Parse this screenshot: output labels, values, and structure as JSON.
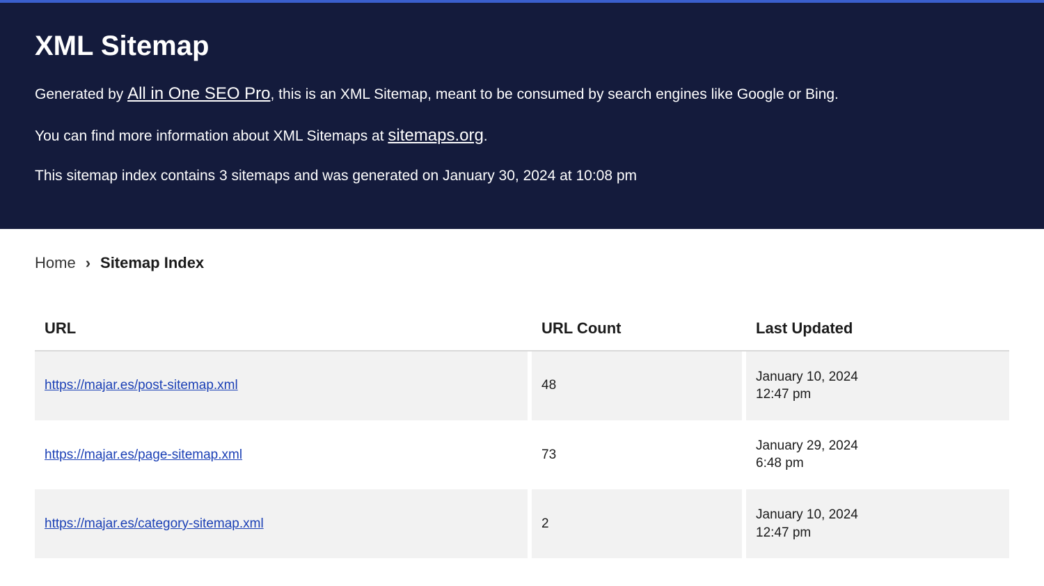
{
  "header": {
    "title": "XML Sitemap",
    "p1_pre": "Generated by ",
    "p1_link": "All in One SEO Pro",
    "p1_post": ", this is an XML Sitemap, meant to be consumed by search engines like Google or Bing.",
    "p2_pre": "You can find more information about XML Sitemaps at ",
    "p2_link": "sitemaps.org",
    "p2_post": ".",
    "p3": "This sitemap index contains 3 sitemaps and was generated on January 30, 2024 at 10:08 pm"
  },
  "breadcrumb": {
    "home": "Home",
    "current": "Sitemap Index"
  },
  "table": {
    "headers": {
      "url": "URL",
      "count": "URL Count",
      "updated": "Last Updated"
    },
    "rows": [
      {
        "url": "https://majar.es/post-sitemap.xml",
        "count": "48",
        "date": "January 10, 2024",
        "time": "12:47 pm"
      },
      {
        "url": "https://majar.es/page-sitemap.xml",
        "count": "73",
        "date": "January 29, 2024",
        "time": "6:48 pm"
      },
      {
        "url": "https://majar.es/category-sitemap.xml",
        "count": "2",
        "date": "January 10, 2024",
        "time": "12:47 pm"
      }
    ]
  }
}
